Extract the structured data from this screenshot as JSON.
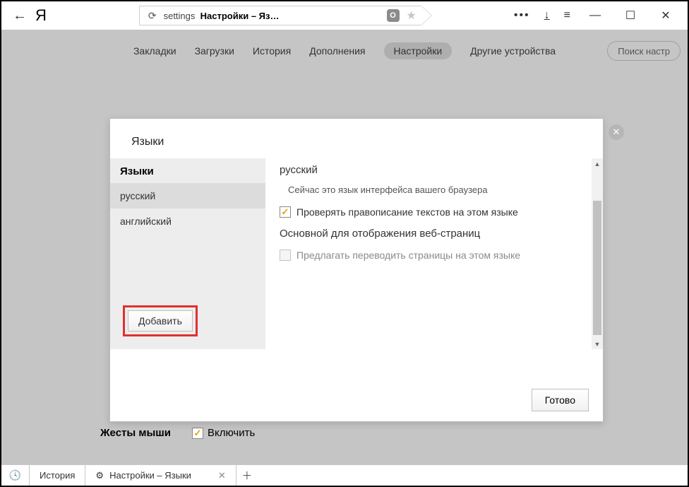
{
  "titlebar": {
    "address_prefix": "settings",
    "address_title": "Настройки – Яз…"
  },
  "nav": {
    "items": [
      "Закладки",
      "Загрузки",
      "История",
      "Дополнения",
      "Настройки",
      "Другие устройства"
    ],
    "active_index": 4,
    "search_placeholder": "Поиск настр"
  },
  "modal": {
    "title": "Языки",
    "list_heading": "Языки",
    "languages": [
      "русский",
      "английский"
    ],
    "selected_index": 0,
    "add_label": "Добавить",
    "detail": {
      "name": "русский",
      "interface_note": "Сейчас это язык интерфейса вашего браузера",
      "spellcheck_label": "Проверять правописание текстов на этом языке",
      "spellcheck_checked": true,
      "display_heading": "Основной для отображения веб-страниц",
      "translate_label": "Предлагать переводить страницы на этом языке",
      "translate_checked": false,
      "translate_enabled": false
    },
    "done_label": "Готово"
  },
  "background": {
    "mouse_gestures_heading": "Жесты мыши",
    "mouse_gestures_enable": "Включить",
    "mouse_gestures_checked": true
  },
  "tabstrip": {
    "tabs": [
      {
        "label": "История"
      },
      {
        "label": "Настройки – Языки"
      }
    ],
    "active_index": 1
  }
}
